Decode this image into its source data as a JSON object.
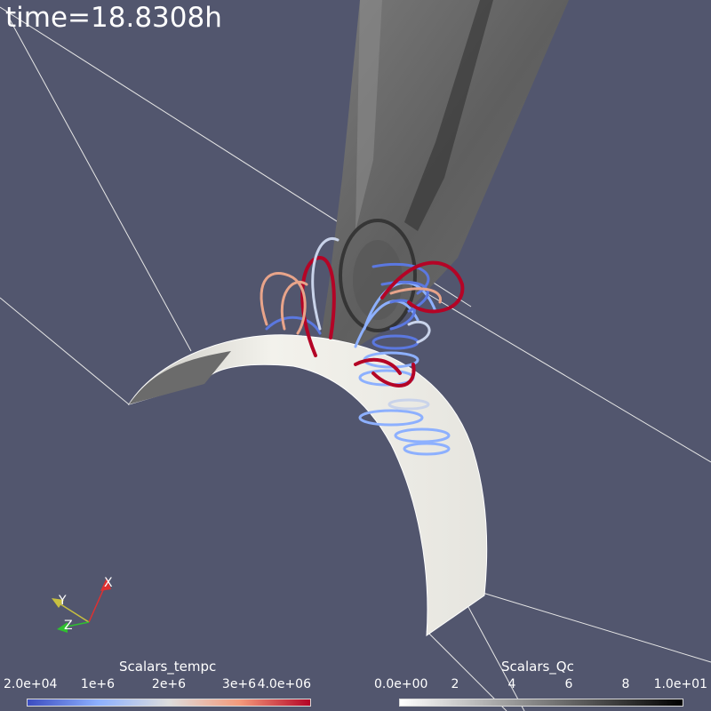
{
  "time_label": "time=18.8308h",
  "colorbars": [
    {
      "title": "Scalars_tempc",
      "ticks": [
        "2.0e+04",
        "1e+6",
        "2e+6",
        "3e+6",
        "4.0e+06"
      ],
      "colormap": "cool-to-warm",
      "colors": [
        "#3b4cc0",
        "#8db0fe",
        "#dddddd",
        "#f49a7b",
        "#b40426"
      ]
    },
    {
      "title": "Scalars_Qc",
      "ticks": [
        "0.0e+00",
        "2",
        "4",
        "6",
        "8",
        "1.0e+01"
      ],
      "colormap": "white-to-black",
      "colors": [
        "#ffffff",
        "#000000"
      ]
    }
  ],
  "axes_triad": {
    "labels": [
      "X",
      "Y",
      "Z"
    ],
    "colors": {
      "X": "#e03030",
      "Y": "#c8c040",
      "Z": "#30c030"
    }
  },
  "scene_colors": {
    "background": "#52566e",
    "surface": "#f0efe9",
    "plane": "#6e6e6e",
    "outline": "#e8e8e8"
  }
}
